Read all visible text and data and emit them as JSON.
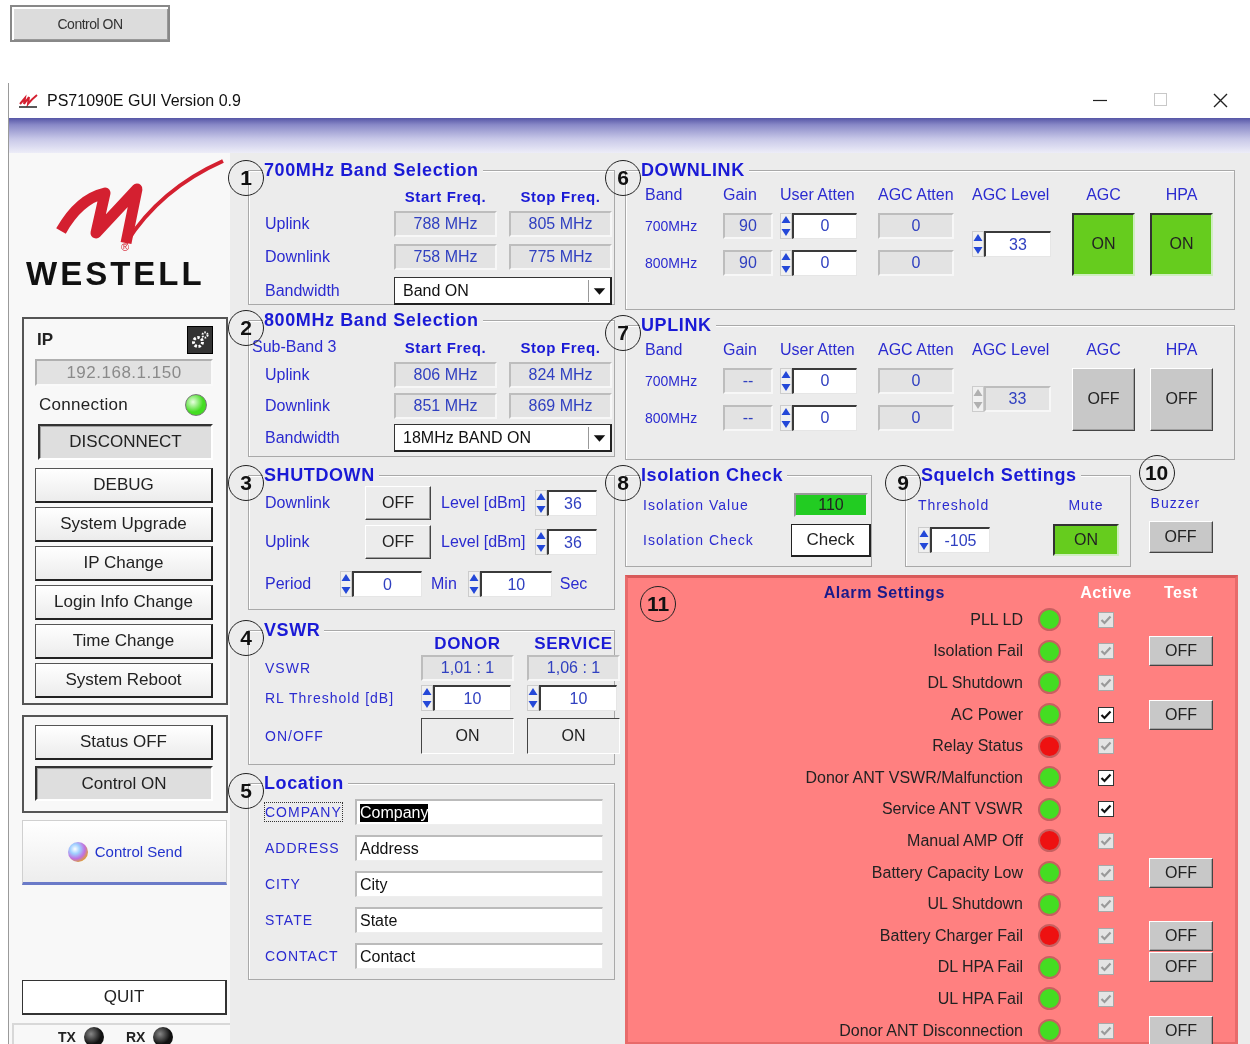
{
  "top_button": {
    "label": "Control ON"
  },
  "window": {
    "title": "PS71090E GUI Version 0.9"
  },
  "sidebar": {
    "logo": {
      "text": "WESTELL",
      "mark": "®"
    },
    "ip": {
      "label": "IP",
      "value": "192.168.1.150"
    },
    "connection": {
      "label": "Connection",
      "on": true
    },
    "disconnect": {
      "label": "DISCONNECT",
      "pressed": true
    },
    "menu_buttons": [
      "DEBUG",
      "System Upgrade",
      "IP Change",
      "Login Info Change",
      "Time Change",
      "System Reboot"
    ],
    "mode_buttons": [
      {
        "label": "Status OFF",
        "pressed": false
      },
      {
        "label": "Control ON",
        "pressed": true
      }
    ],
    "send_button": "Control Send",
    "quit_button": "QUIT",
    "indicators": [
      {
        "label": "TX",
        "on": false
      },
      {
        "label": "RX",
        "on": false
      }
    ]
  },
  "band_sections": [
    {
      "number": "1",
      "title": "700MHz Band Selection",
      "columns": [
        "Start Freq.",
        "Stop Freq."
      ],
      "rows": [
        {
          "label": "Uplink",
          "values": [
            "788 MHz",
            "805 MHz"
          ]
        },
        {
          "label": "Downlink",
          "values": [
            "758 MHz",
            "775 MHz"
          ]
        }
      ],
      "bandwidth": {
        "label": "Bandwidth",
        "value": "Band ON"
      }
    },
    {
      "number": "2",
      "title": "800MHz Band Selection",
      "subtitle": "Sub-Band 3",
      "columns": [
        "Start Freq.",
        "Stop Freq."
      ],
      "rows": [
        {
          "label": "Uplink",
          "values": [
            "806 MHz",
            "824 MHz"
          ]
        },
        {
          "label": "Downlink",
          "values": [
            "851 MHz",
            "869 MHz"
          ]
        }
      ],
      "bandwidth": {
        "label": "Bandwidth",
        "value": "18MHz BAND ON"
      }
    }
  ],
  "shutdown": {
    "number": "3",
    "title": "SHUTDOWN",
    "rows": [
      {
        "label": "Downlink",
        "state": "OFF",
        "level_label": "Level [dBm]",
        "value": "36"
      },
      {
        "label": "Uplink",
        "state": "OFF",
        "level_label": "Level [dBm]",
        "value": "36"
      }
    ],
    "period": {
      "label": "Period",
      "minutes": "0",
      "min_unit": "Min",
      "seconds": "10",
      "sec_unit": "Sec"
    }
  },
  "vswr": {
    "number": "4",
    "title": "VSWR",
    "columns": [
      "DONOR",
      "SERVICE"
    ],
    "vswr": {
      "label": "VSWR",
      "values": [
        "1,01 : 1",
        "1,06 : 1"
      ]
    },
    "threshold": {
      "label": "RL Threshold [dB]",
      "values": [
        "10",
        "10"
      ]
    },
    "onoff": {
      "label": "ON/OFF",
      "values": [
        "ON",
        "ON"
      ]
    }
  },
  "location": {
    "number": "5",
    "title": "Location",
    "fields": [
      {
        "label": "COMPANY",
        "value": "Company",
        "focused": true
      },
      {
        "label": "ADDRESS",
        "value": "Address",
        "focused": false
      },
      {
        "label": "CITY",
        "value": "City",
        "focused": false
      },
      {
        "label": "STATE",
        "value": "State",
        "focused": false
      },
      {
        "label": "CONTACT",
        "value": "Contact",
        "focused": false
      }
    ]
  },
  "link_sections": [
    {
      "number": "6",
      "title": "DOWNLINK",
      "columns": [
        "Band",
        "Gain",
        "User Atten",
        "AGC Atten",
        "AGC Level",
        "AGC",
        "HPA"
      ],
      "rows": [
        {
          "band": "700MHz",
          "gain": "90",
          "user_atten": "0",
          "agc_atten": "0"
        },
        {
          "band": "800MHz",
          "gain": "90",
          "user_atten": "0",
          "agc_atten": "0"
        }
      ],
      "agc_level": {
        "value": "33",
        "disabled": false
      },
      "agc": {
        "label": "ON",
        "on": true
      },
      "hpa": {
        "label": "ON",
        "on": true
      }
    },
    {
      "number": "7",
      "title": "UPLINK",
      "columns": [
        "Band",
        "Gain",
        "User Atten",
        "AGC Atten",
        "AGC Level",
        "AGC",
        "HPA"
      ],
      "rows": [
        {
          "band": "700MHz",
          "gain": "--",
          "user_atten": "0",
          "agc_atten": "0"
        },
        {
          "band": "800MHz",
          "gain": "--",
          "user_atten": "0",
          "agc_atten": "0"
        }
      ],
      "agc_level": {
        "value": "33",
        "disabled": true
      },
      "agc": {
        "label": "OFF",
        "on": false
      },
      "hpa": {
        "label": "OFF",
        "on": false
      }
    }
  ],
  "isolation": {
    "number": "8",
    "title": "Isolation Check",
    "value_label": "Isolation Value",
    "value": "110",
    "passed": true,
    "check_label": "Isolation Check",
    "check_button": "Check"
  },
  "squelch": {
    "number": "9",
    "title": "Squelch Settings",
    "threshold_label": "Threshold",
    "threshold": "-105",
    "mute_label": "Mute",
    "mute": {
      "label": "ON",
      "on": true
    }
  },
  "buzzer": {
    "number": "10",
    "label": "Buzzer",
    "button": {
      "label": "OFF",
      "on": false
    }
  },
  "alarms": {
    "number": "11",
    "title": "Alarm Settings",
    "active_header": "Active",
    "test_header": "Test",
    "items": [
      {
        "name": "PLL LD",
        "color": "#44dd22",
        "checked": true,
        "disabled": true
      },
      {
        "name": "Isolation Fail",
        "color": "#44dd22",
        "checked": true,
        "disabled": true,
        "test": "OFF"
      },
      {
        "name": "DL Shutdown",
        "color": "#44dd22",
        "checked": true,
        "disabled": true
      },
      {
        "name": "AC Power",
        "color": "#44dd22",
        "checked": true,
        "disabled": false,
        "test": "OFF"
      },
      {
        "name": "Relay Status",
        "color": "#ee1111",
        "checked": true,
        "disabled": true
      },
      {
        "name": "Donor ANT VSWR/Malfunction",
        "color": "#44dd22",
        "checked": true,
        "disabled": false
      },
      {
        "name": "Service ANT VSWR",
        "color": "#44dd22",
        "checked": true,
        "disabled": false
      },
      {
        "name": "Manual AMP Off",
        "color": "#ee1111",
        "checked": true,
        "disabled": true
      },
      {
        "name": "Battery Capacity Low",
        "color": "#44dd22",
        "checked": true,
        "disabled": true,
        "test": "OFF"
      },
      {
        "name": "UL Shutdown",
        "color": "#44dd22",
        "checked": true,
        "disabled": true
      },
      {
        "name": "Battery Charger Fail",
        "color": "#ee1111",
        "checked": true,
        "disabled": true,
        "test": "OFF"
      },
      {
        "name": "DL HPA Fail",
        "color": "#44dd22",
        "checked": true,
        "disabled": true,
        "test": "OFF"
      },
      {
        "name": "UL HPA Fail",
        "color": "#44dd22",
        "checked": true,
        "disabled": true
      },
      {
        "name": "Donor ANT Disconnection",
        "color": "#44dd22",
        "checked": true,
        "disabled": true,
        "test": "OFF"
      }
    ]
  }
}
